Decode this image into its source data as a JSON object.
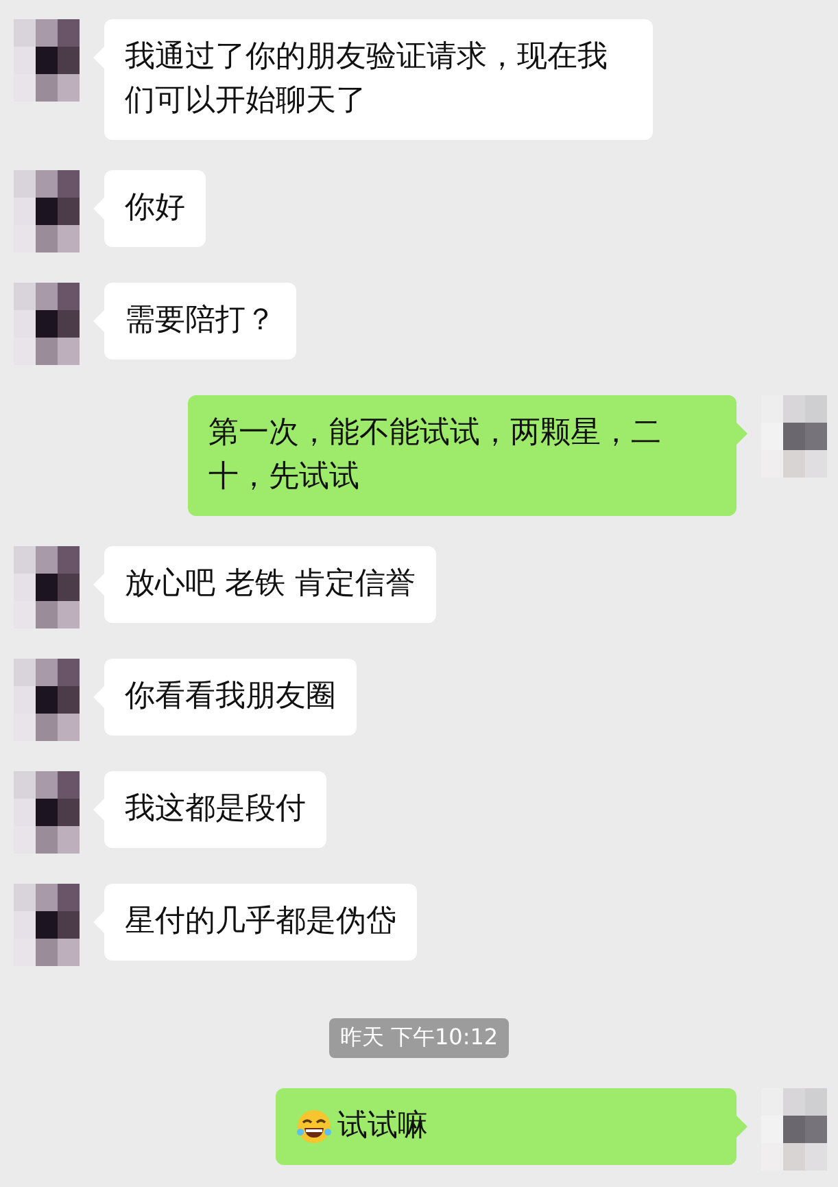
{
  "messages": [
    {
      "kind": "text",
      "outgoing": false,
      "text": "我通过了你的朋友验证请求，现在我们可以开始聊天了"
    },
    {
      "kind": "text",
      "outgoing": false,
      "text": "你好"
    },
    {
      "kind": "text",
      "outgoing": false,
      "text": "需要陪打？"
    },
    {
      "kind": "text",
      "outgoing": true,
      "text": "第一次，能不能试试，两颗星，二十，先试试"
    },
    {
      "kind": "text",
      "outgoing": false,
      "text": "放心吧 老铁 肯定信誉"
    },
    {
      "kind": "text",
      "outgoing": false,
      "text": "你看看我朋友圈"
    },
    {
      "kind": "text",
      "outgoing": false,
      "text": "我这都是段付"
    },
    {
      "kind": "text",
      "outgoing": false,
      "text": "星付的几乎都是伪岱"
    },
    {
      "kind": "time",
      "text": "昨天 下午10:12"
    },
    {
      "kind": "emoji_text",
      "outgoing": true,
      "text": "试试嘛"
    }
  ]
}
